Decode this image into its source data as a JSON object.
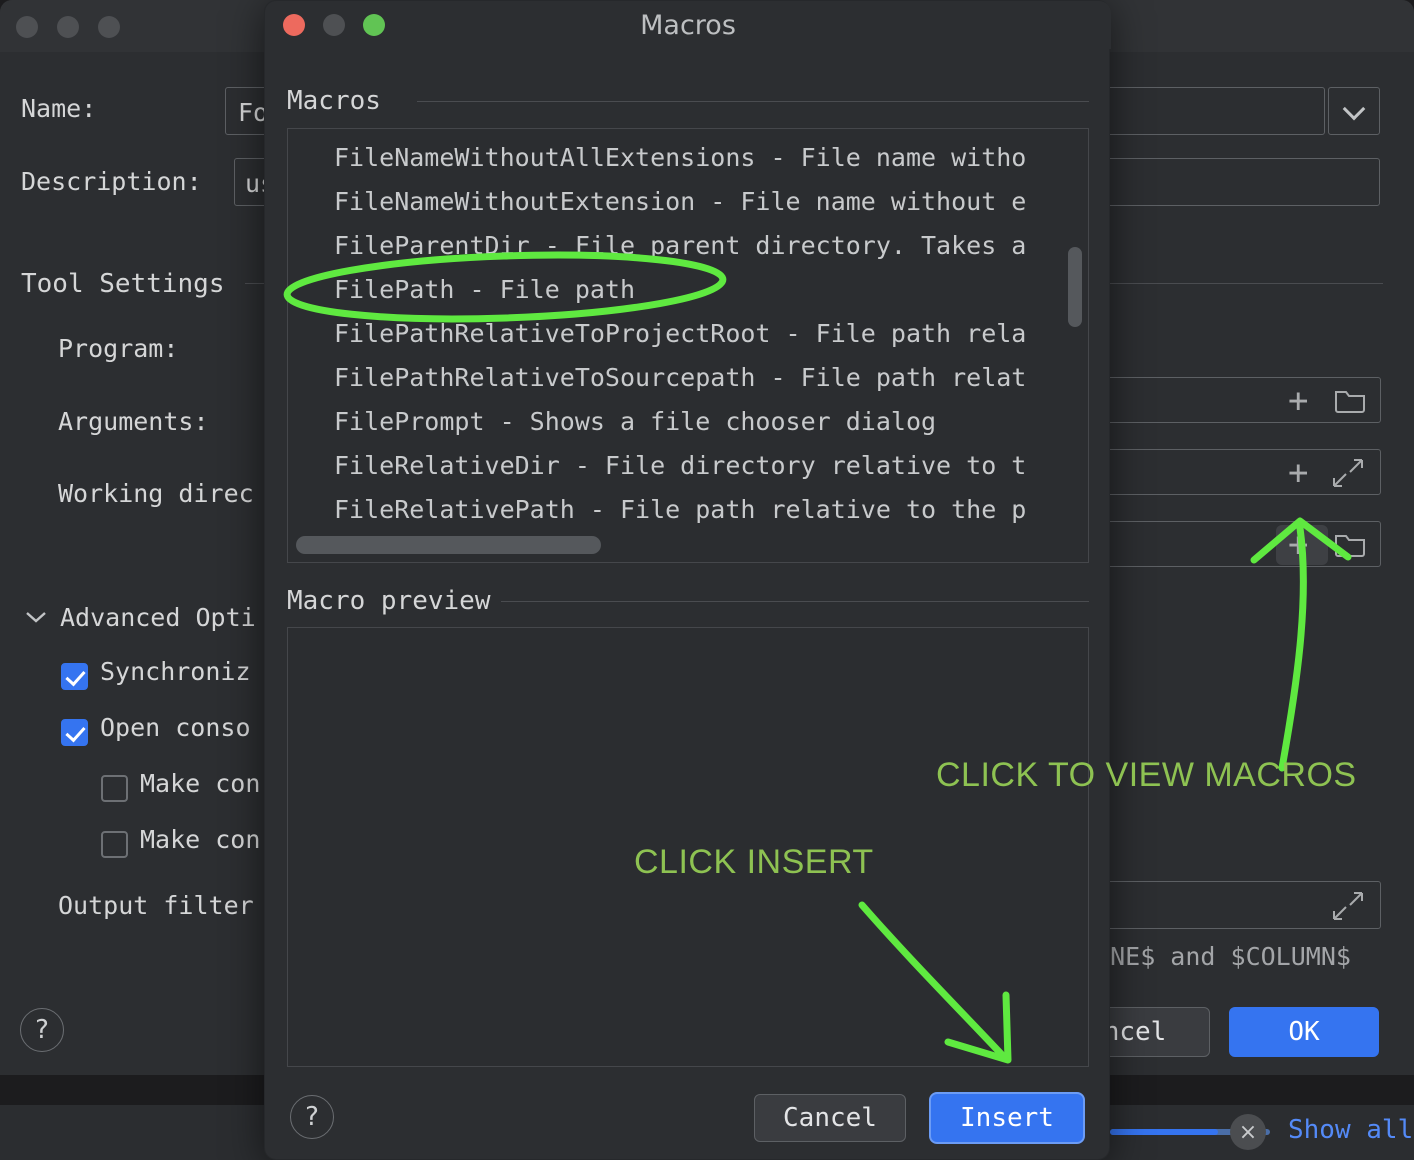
{
  "background_window": {
    "name_label": "Name:",
    "name_value": "Fo",
    "description_label": "Description:",
    "description_value": "us",
    "tool_settings_title": "Tool Settings",
    "program_label": "Program:",
    "arguments_label": "Arguments:",
    "working_directory_label": "Working direc",
    "advanced_options_label": "Advanced Opti",
    "checkboxes": [
      {
        "label": "Synchroniz",
        "checked": true
      },
      {
        "label": "Open conso",
        "checked": true
      },
      {
        "label": "Make con",
        "checked": false
      },
      {
        "label": "Make con",
        "checked": false
      }
    ],
    "output_filters_label": "Output filter",
    "hint_text": "LINE$ and $COLUMN$",
    "cancel_label": "ncel",
    "ok_label": "OK",
    "help_label": "?",
    "traffic_lights": [
      "inactive",
      "inactive",
      "inactive"
    ],
    "row_icons": [
      {
        "plus": "+",
        "trailing": "folder-icon",
        "highlighted": false
      },
      {
        "plus": "+",
        "trailing": "expand-icon",
        "highlighted": false
      },
      {
        "plus": "+",
        "trailing": "folder-icon",
        "highlighted": true
      }
    ],
    "expand_icon": "expand-icon",
    "dropdown_icon": "chevron-down-icon"
  },
  "status_bar": {
    "progress_percent": 72,
    "close_label": "×",
    "show_all_label": "Show all"
  },
  "macros_dialog": {
    "title": "Macros",
    "traffic_lights": [
      "close",
      "minimize",
      "zoom"
    ],
    "macros_group_label": "Macros",
    "macro_preview_group_label": "Macro preview",
    "macro_preview_value": "",
    "selected_macro": "FilePath",
    "macros": [
      "FileNameWithoutAllExtensions - File name witho",
      "FileNameWithoutExtension - File name without e",
      "FileParentDir - File parent directory. Takes a",
      "FilePath - File path",
      "FilePathRelativeToProjectRoot - File path rela",
      "FilePathRelativeToSourcepath - File path relat",
      "FilePrompt - Shows a file chooser dialog",
      "FileRelativeDir - File directory relative to t",
      "FileRelativePath - File path relative to the p"
    ],
    "help_label": "?",
    "cancel_label": "Cancel",
    "insert_label": "Insert"
  },
  "annotations": {
    "stroke_color": "#5FE940",
    "text_color": "#8EC252",
    "items": [
      {
        "kind": "ellipse",
        "target": "FilePath - File path"
      },
      {
        "kind": "arrow",
        "label": "CLICK TO VIEW MACROS"
      },
      {
        "kind": "arrow",
        "label": "CLICK INSERT"
      }
    ],
    "view_macros_text": "CLICK TO VIEW MACROS",
    "click_insert_text": "CLICK INSERT"
  }
}
